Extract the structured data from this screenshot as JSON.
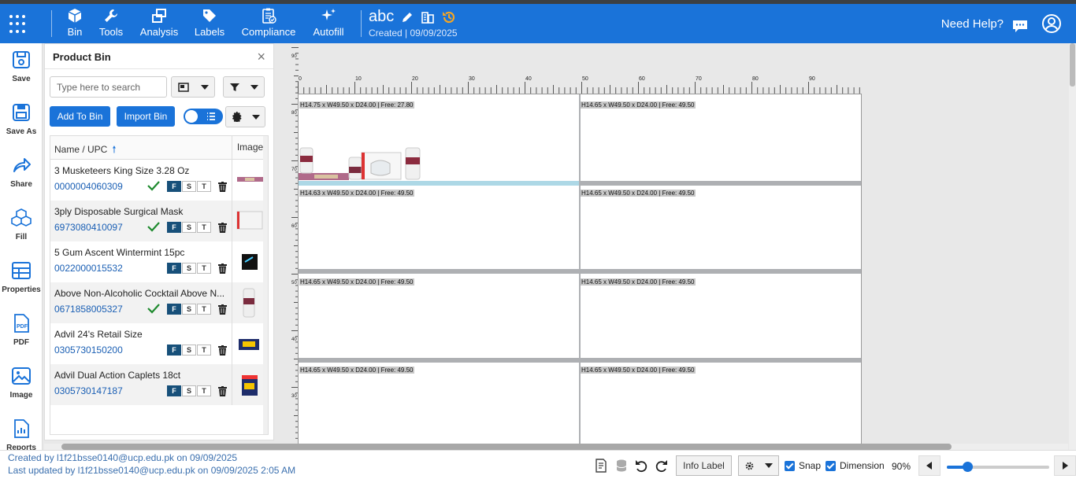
{
  "topnav": {
    "items": [
      {
        "label": "Bin",
        "icon": "cube-icon"
      },
      {
        "label": "Tools",
        "icon": "wrench-icon"
      },
      {
        "label": "Analysis",
        "icon": "analysis-icon"
      },
      {
        "label": "Labels",
        "icon": "tags-icon"
      },
      {
        "label": "Compliance",
        "icon": "clipboard-check-icon"
      },
      {
        "label": "Autofill",
        "icon": "sparkle-icon"
      }
    ],
    "project_name": "abc",
    "project_meta": "Created  |  09/09/2025",
    "help_label": "Need Help?"
  },
  "leftrail": {
    "items": [
      {
        "label": "Save",
        "icon": "save-icon"
      },
      {
        "label": "Save As",
        "icon": "save-as-icon"
      },
      {
        "label": "Share",
        "icon": "share-icon"
      },
      {
        "label": "Fill",
        "icon": "fill-cubes-icon"
      },
      {
        "label": "Properties",
        "icon": "table-icon"
      },
      {
        "label": "PDF",
        "icon": "pdf-icon"
      },
      {
        "label": "Image",
        "icon": "image-icon"
      },
      {
        "label": "Reports",
        "icon": "report-icon"
      }
    ]
  },
  "bin": {
    "title": "Product Bin",
    "close": "×",
    "search_placeholder": "Type here to search",
    "add_label": "Add To Bin",
    "import_label": "Import Bin",
    "col_name": "Name / UPC",
    "col_image": "Image",
    "fst": [
      "F",
      "S",
      "T"
    ],
    "rows": [
      {
        "name": "3 Musketeers King Size 3.28 Oz",
        "upc": "0000004060309",
        "checked": true
      },
      {
        "name": "3ply Disposable Surgical Mask",
        "upc": "6973080410097",
        "checked": true
      },
      {
        "name": "5 Gum Ascent Wintermint 15pc",
        "upc": "0022000015532",
        "checked": false
      },
      {
        "name": "Above Non-Alcoholic Cocktail Above N...",
        "upc": "0671858005327",
        "checked": true
      },
      {
        "name": "Advil 24's Retail Size",
        "upc": "0305730150200",
        "checked": false
      },
      {
        "name": "Advil Dual Action Caplets 18ct",
        "upc": "0305730147187",
        "checked": false
      }
    ]
  },
  "planogram": {
    "vruler_labels": [
      "90",
      "80",
      "70",
      "60",
      "50",
      "40",
      "30"
    ],
    "hruler_labels": [
      "0",
      "10",
      "20",
      "30",
      "40",
      "50",
      "60",
      "70",
      "80",
      "90"
    ],
    "shelves": [
      {
        "left": "H14.75 x W49.50 x D24.00 | Free: 27.80",
        "right": "H14.65 x W49.50 x D24.00 | Free: 49.50"
      },
      {
        "left": "H14.63 x W49.50 x D24.00 | Free: 49.50",
        "right": "H14.65 x W49.50 x D24.00 | Free: 49.50"
      },
      {
        "left": "H14.65 x W49.50 x D24.00 | Free: 49.50",
        "right": "H14.65 x W49.50 x D24.00 | Free: 49.50"
      },
      {
        "left": "H14.65 x W49.50 x D24.00 | Free: 49.50",
        "right": "H14.65 x W49.50 x D24.00 | Free: 49.50"
      }
    ]
  },
  "status": {
    "created": "Created by l1f21bsse0140@ucp.edu.pk on 09/09/2025",
    "updated": "Last updated by l1f21bsse0140@ucp.edu.pk on 09/09/2025 2:05 AM",
    "info_label": "Info Label",
    "snap_label": "Snap",
    "dimension_label": "Dimension",
    "zoom": "90%",
    "zoom_fraction": 0.2
  },
  "colors": {
    "brand": "#1a73d9",
    "shelf": "#aeb0b3"
  }
}
